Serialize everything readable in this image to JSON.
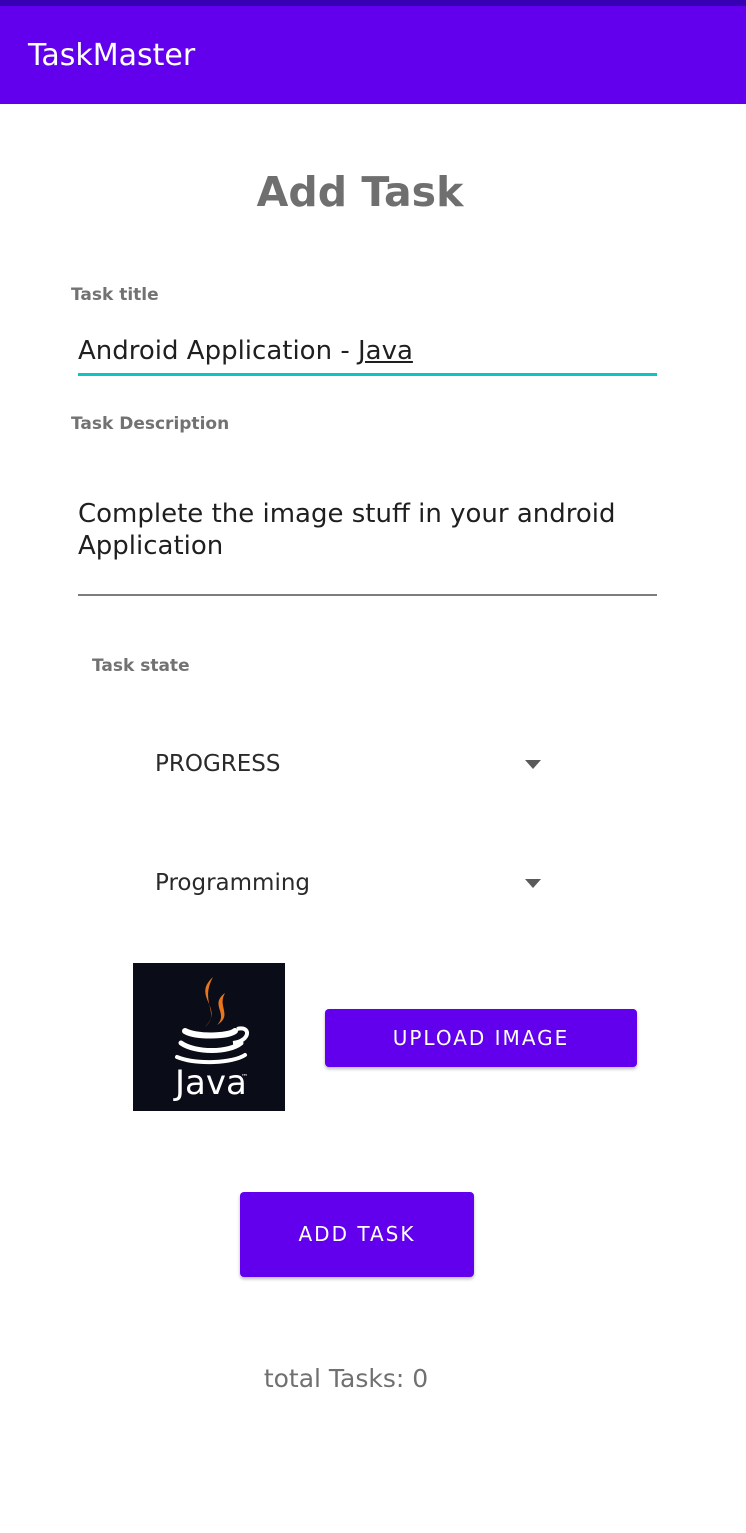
{
  "app_bar": {
    "title": "TaskMaster"
  },
  "page": {
    "title": "Add Task"
  },
  "task_title": {
    "label": "Task title",
    "value_prefix": "Android Application - ",
    "value_underlined": "Java"
  },
  "task_description": {
    "label": "Task Description",
    "value": "Complete the image stuff in your android Application"
  },
  "task_state": {
    "label": "Task state"
  },
  "spinners": {
    "state_value": "PROGRESS",
    "category_value": "Programming"
  },
  "image": {
    "logo_text": "Java",
    "logo_tm": "™",
    "icon": "java-logo-icon"
  },
  "buttons": {
    "upload_label": "UPLOAD IMAGE",
    "add_label": "ADD TASK"
  },
  "footer": {
    "total_tasks": "total Tasks: 0"
  },
  "colors": {
    "primary": "#6200ee",
    "primary_dark": "#3700b3",
    "accent": "#12c2c2"
  }
}
